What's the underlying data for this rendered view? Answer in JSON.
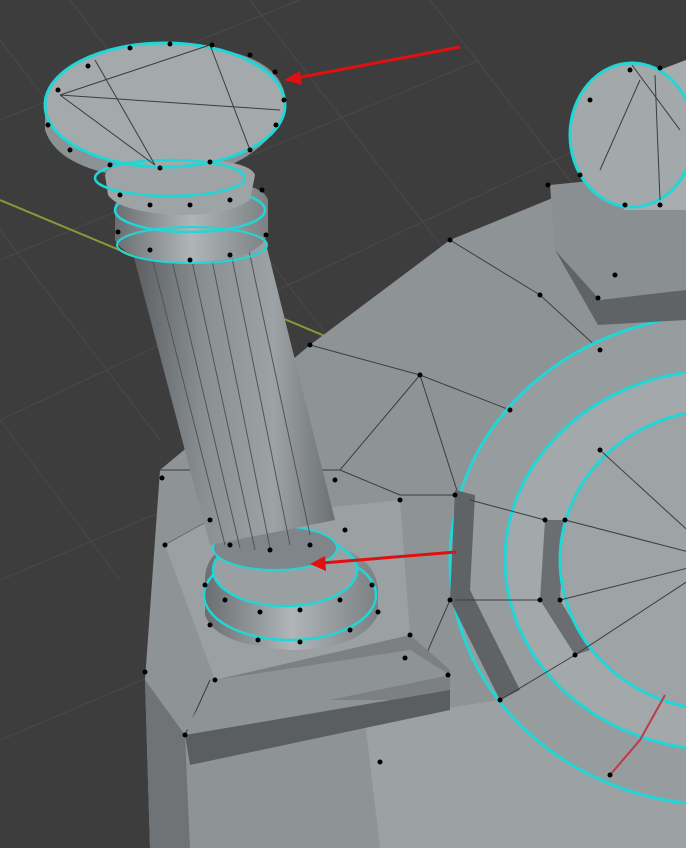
{
  "viewport": {
    "name": "3d-viewport",
    "background_color": "#3d3d3d",
    "grid_color": "#4a4a4a",
    "x_axis_color": "#8a9a3a",
    "mesh_face_color": "#8e9396",
    "mesh_face_light": "#a3a8aa",
    "mesh_face_dark": "#5f6366",
    "selected_edge_color": "#21d6d6",
    "vertex_color": "#000000",
    "seam_edge_color": "#c0394a",
    "annotation_arrow_color": "#e01010"
  },
  "annotations": [
    {
      "name": "arrow-top-capital",
      "target": "column-capital-edge-loop"
    },
    {
      "name": "arrow-column-base",
      "target": "column-base-edge-loop"
    }
  ],
  "objects": [
    {
      "name": "column",
      "mode": "edit"
    },
    {
      "name": "column-right"
    },
    {
      "name": "platform-disc"
    }
  ]
}
